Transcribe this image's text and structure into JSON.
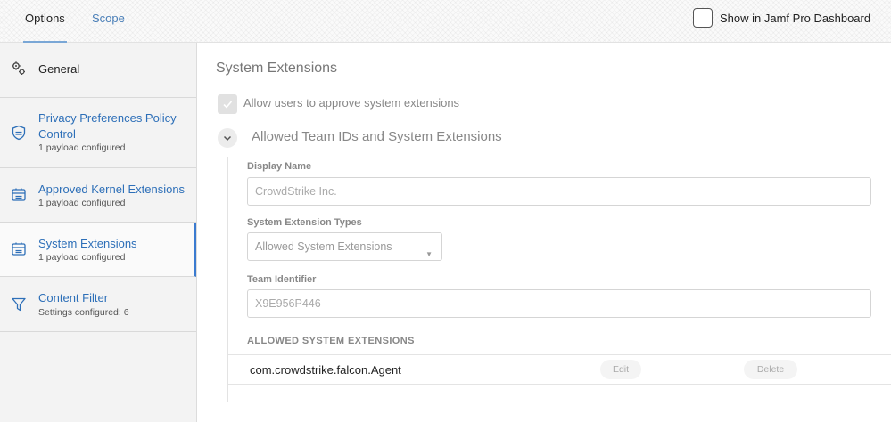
{
  "tabs": {
    "options": "Options",
    "scope": "Scope"
  },
  "dashboard": {
    "label": "Show in Jamf Pro Dashboard",
    "checked": false
  },
  "sidebar": {
    "items": [
      {
        "title": "General",
        "subtitle": "",
        "icon": "gear-icon"
      },
      {
        "title": "Privacy Preferences Policy Control",
        "subtitle": "1 payload configured",
        "icon": "shield-icon"
      },
      {
        "title": "Approved Kernel Extensions",
        "subtitle": "1 payload configured",
        "icon": "extension-icon"
      },
      {
        "title": "System Extensions",
        "subtitle": "1 payload configured",
        "icon": "extension-icon",
        "active": true
      },
      {
        "title": "Content Filter",
        "subtitle": "Settings configured: 6",
        "icon": "filter-icon"
      }
    ]
  },
  "main": {
    "section_title": "System Extensions",
    "allow_users_label": "Allow users to approve system extensions",
    "allow_users_checked": true,
    "subsection_title": "Allowed Team IDs and System Extensions",
    "display_name_label": "Display Name",
    "display_name_value": "CrowdStrike Inc.",
    "types_label": "System Extension Types",
    "types_value": "Allowed System Extensions",
    "team_id_label": "Team Identifier",
    "team_id_value": "X9E956P446",
    "allowed_header": "ALLOWED SYSTEM EXTENSIONS",
    "extensions": [
      {
        "name": "com.crowdstrike.falcon.Agent",
        "edit_label": "Edit",
        "delete_label": "Delete"
      }
    ]
  },
  "colors": {
    "accent": "#3b7bd0",
    "link": "#2d6fb8"
  }
}
